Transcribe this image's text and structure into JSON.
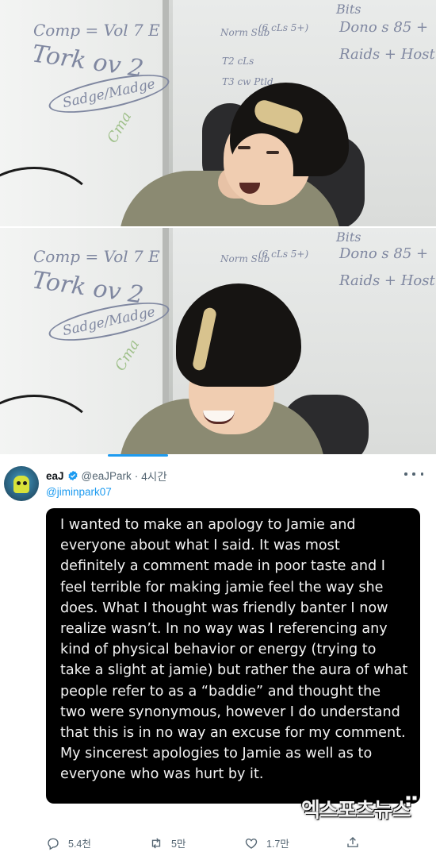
{
  "scene": {
    "whiteboard_lines": [
      "Comp = Vol 7 E",
      "Tork ov 2",
      "Sadge/Madge",
      "Norm Sub",
      "(6 cLs 5+)",
      "T2 cLs",
      "T3 cw Ptld",
      "Bits",
      "Dono s 85 +",
      "Raids + Host"
    ]
  },
  "tweet": {
    "author_name": "eaJ",
    "author_handle": "@eaJPark",
    "separator": "·",
    "time": "4시간",
    "reply_to": "@jiminpark07",
    "image_text": "I wanted to make an apology to Jamie and everyone about what I said. It was most definitely a comment made in poor taste and I feel terrible for making jamie feel the way she does. What I thought was friendly banter I now realize wasn’t. In no way was I referencing any kind of physical behavior or energy (trying to take a slight at jamie) but rather the aura of what people refer to as a “baddie” and thought the two were synonymous, however I do understand that this is in no way an excuse for my comment. My sincerest apologies to Jamie as well as to everyone who was hurt by it.",
    "watermark": "엑스포츠뉴스",
    "actions": {
      "reply_count": "5.4천",
      "retweet_count": "5만",
      "like_count": "1.7만"
    },
    "icons": [
      "verified-icon",
      "more-icon",
      "reply-icon",
      "retweet-icon",
      "like-icon",
      "share-icon"
    ],
    "accent_color": "#1d9bf0"
  }
}
